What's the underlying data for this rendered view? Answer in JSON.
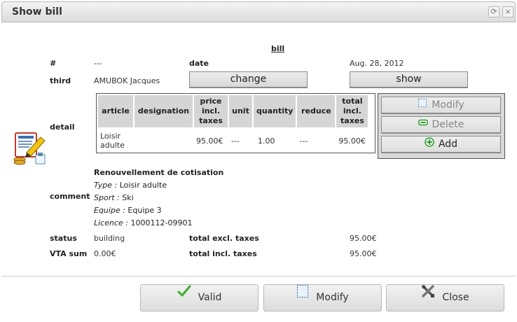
{
  "dialog": {
    "title": "Show bill",
    "btn_restore_glyph": "⟳",
    "btn_close_glyph": "×"
  },
  "heading": "bill",
  "fields": {
    "number_label": "#",
    "number_value": "---",
    "date_label": "date",
    "date_value": "Aug. 28, 2012",
    "third_label": "third",
    "third_value": "AMUBOK Jacques",
    "change_button": "change",
    "show_button": "show",
    "detail_label": "detail",
    "comment_label": "comment",
    "status_label": "status",
    "status_value": "building",
    "vta_label": "VTA sum",
    "vta_value": "0.00€",
    "total_excl_label": "total excl. taxes",
    "total_excl_value": "95.00€",
    "total_incl_label": "total incl. taxes",
    "total_incl_value": "95.00€"
  },
  "detail_table": {
    "headers": [
      "article",
      "designation",
      "price incl. taxes",
      "unit",
      "quantity",
      "reduce",
      "total incl. taxes"
    ],
    "rows": [
      [
        "Loisir adulte",
        "",
        "95.00€",
        "---",
        "1.00",
        "---",
        "95.00€"
      ]
    ]
  },
  "detail_actions": {
    "modify": "Modify",
    "delete": "Delete",
    "add": "Add"
  },
  "comment": {
    "title": "Renouvellement de cotisation",
    "lines": [
      {
        "key": "Type :",
        "value": "Loisir adulte"
      },
      {
        "key": "Sport :",
        "value": "Ski"
      },
      {
        "key": "Equipe :",
        "value": "Equipe 3"
      },
      {
        "key": "Licence :",
        "value": "1000112-09901"
      }
    ]
  },
  "footer": {
    "valid": "Valid",
    "modify": "Modify",
    "close": "Close"
  },
  "icons": {
    "invoice": "invoice-edit-icon",
    "valid": "checkmark-icon",
    "modify": "frame-icon",
    "close": "tools-close-icon",
    "delete": "minus-icon",
    "add": "plus-icon"
  },
  "colors": {
    "titlebar": "#dcdcdc",
    "table_header": "#d5d5d5",
    "action_panel": "#d8d8d8",
    "check_green": "#3cae2a",
    "add_green": "#2a9a2a"
  }
}
